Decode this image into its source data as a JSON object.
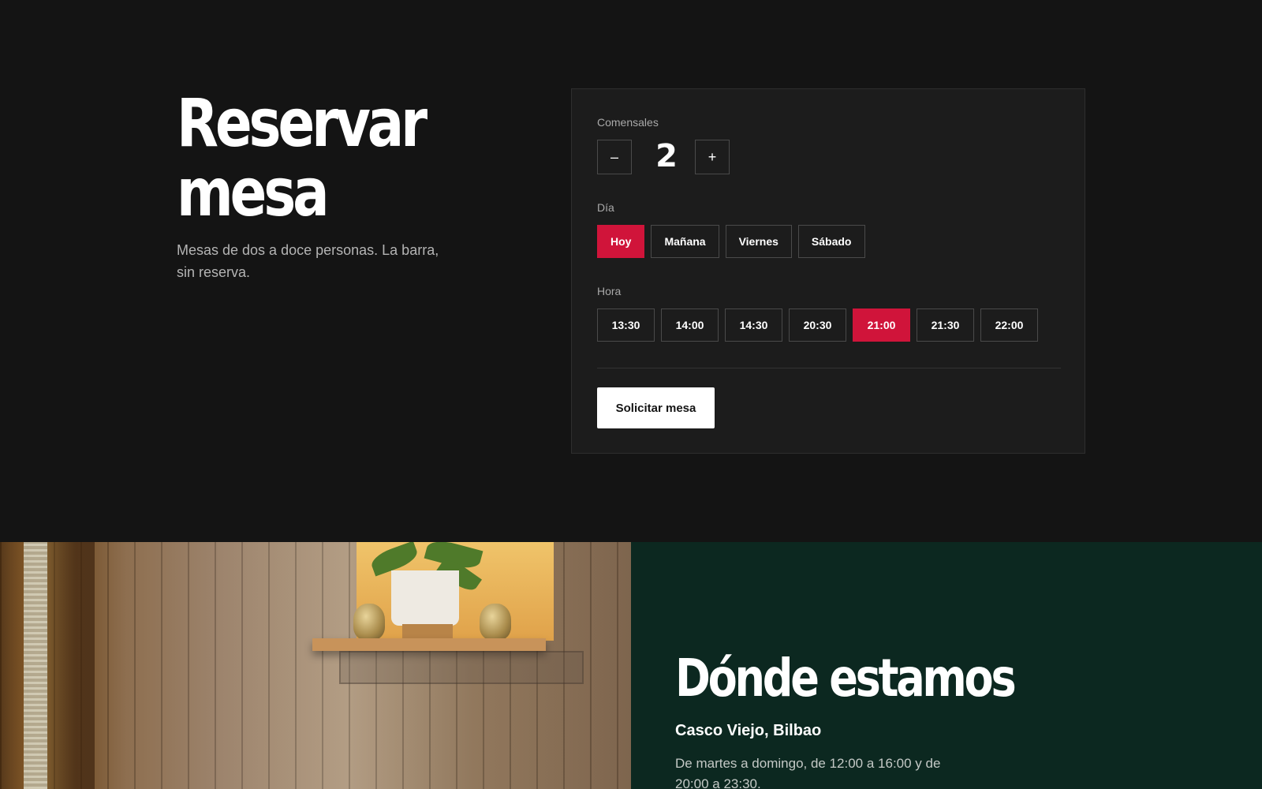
{
  "reservation": {
    "title": "Reservar mesa",
    "subtitle": "Mesas de dos a doce personas. La barra, sin reserva.",
    "guests": {
      "label": "Comensales",
      "decrement_label": "–",
      "increment_label": "+",
      "value": "2"
    },
    "day": {
      "label": "Día",
      "options": [
        "Hoy",
        "Mañana",
        "Viernes",
        "Sábado"
      ],
      "selected": "Hoy"
    },
    "time": {
      "label": "Hora",
      "options": [
        "13:30",
        "14:00",
        "14:30",
        "20:30",
        "21:00",
        "21:30",
        "22:00"
      ],
      "selected": "21:00"
    },
    "submit_label": "Solicitar mesa"
  },
  "location": {
    "title": "Dónde estamos",
    "place": "Casco Viejo, Bilbao",
    "hours": "De martes a domingo, de 12:00 a 16:00 y de 20:00 a 23:30."
  },
  "colors": {
    "background": "#141414",
    "panel": "#1c1c1c",
    "accent": "#d0143a",
    "location_background": "#0c2820"
  }
}
